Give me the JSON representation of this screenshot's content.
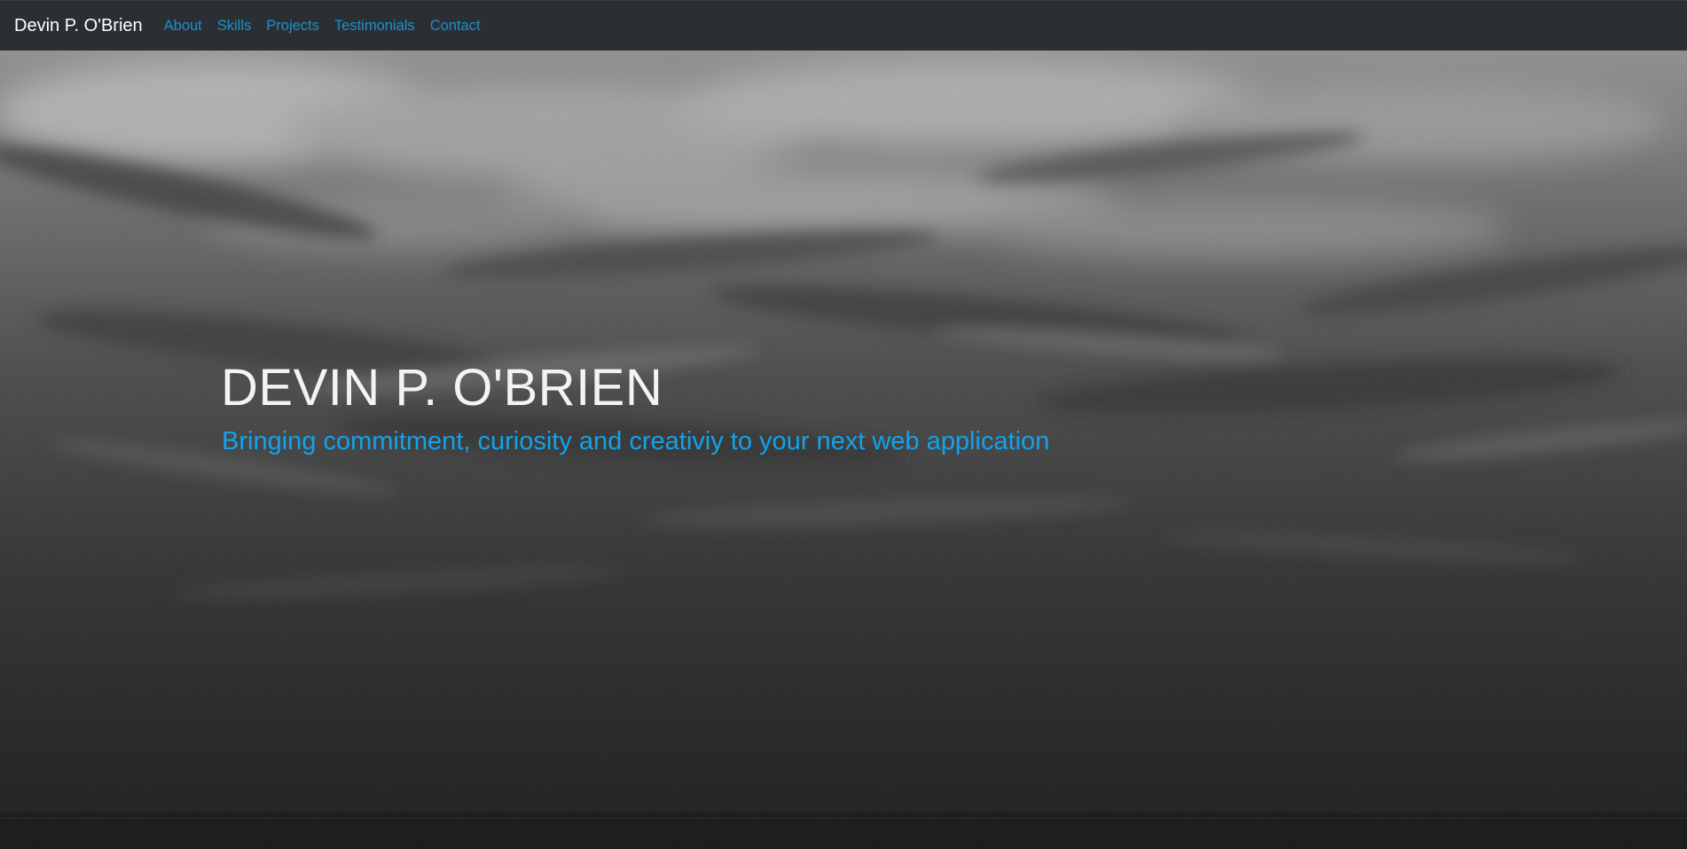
{
  "navbar": {
    "brand": "Devin P. O'Brien",
    "links": [
      {
        "label": "About"
      },
      {
        "label": "Skills"
      },
      {
        "label": "Projects"
      },
      {
        "label": "Testimonials"
      },
      {
        "label": "Contact"
      }
    ]
  },
  "hero": {
    "title": "DEVIN P. O'BRIEN",
    "subtitle": "Bringing commitment, curiosity and creativiy to your next web application"
  },
  "colors": {
    "navbar_bg": "#2b2f33",
    "link": "#1e90c8",
    "subtitle": "#12a3ea",
    "title": "#f3f3f3"
  }
}
